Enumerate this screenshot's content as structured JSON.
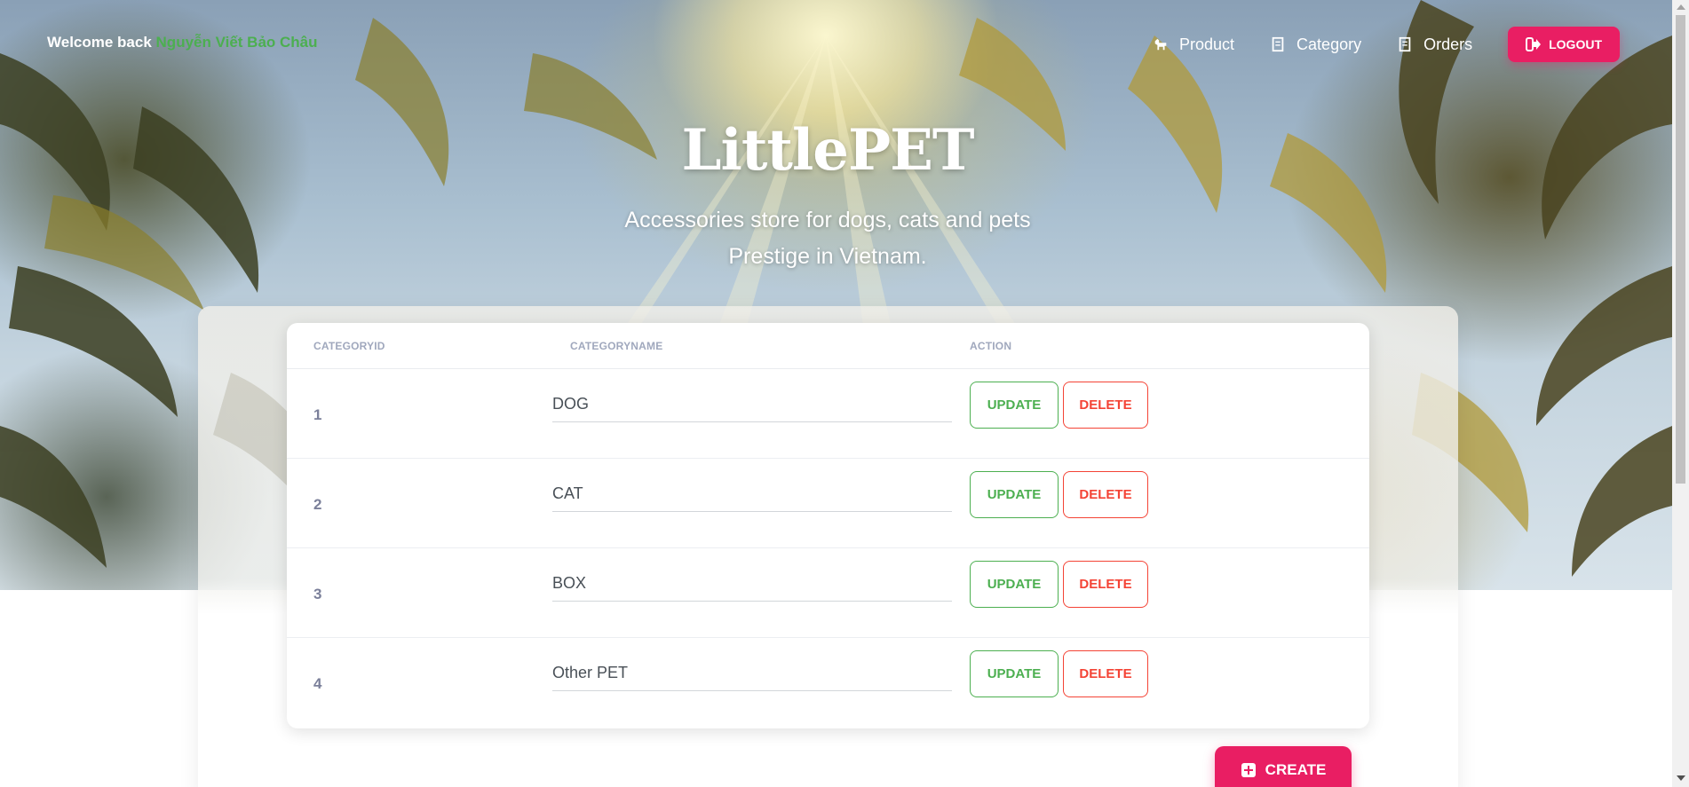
{
  "header": {
    "welcome_prefix": "Welcome back",
    "user_name": "Nguyễn Viết Bảo Châu",
    "nav": [
      {
        "label": "Product",
        "icon": "dog-icon"
      },
      {
        "label": "Category",
        "icon": "receipt-icon"
      },
      {
        "label": "Orders",
        "icon": "receipt-icon"
      }
    ],
    "logout_label": "LOGOUT"
  },
  "hero": {
    "brand": "LittlePET",
    "tagline_line1": "Accessories store for dogs, cats and pets",
    "tagline_line2": "Prestige in Vietnam."
  },
  "table": {
    "columns": [
      "CATEGORYID",
      "CATEGORYNAME",
      "ACTION"
    ],
    "rows": [
      {
        "id": "1",
        "name": "DOG"
      },
      {
        "id": "2",
        "name": "CAT"
      },
      {
        "id": "3",
        "name": "BOX"
      },
      {
        "id": "4",
        "name": "Other PET"
      }
    ],
    "update_label": "UPDATE",
    "delete_label": "DELETE"
  },
  "create_label": "CREATE",
  "colors": {
    "primary": "#e91e63",
    "success": "#4caf50",
    "danger": "#f44335",
    "muted": "#7b809a"
  }
}
